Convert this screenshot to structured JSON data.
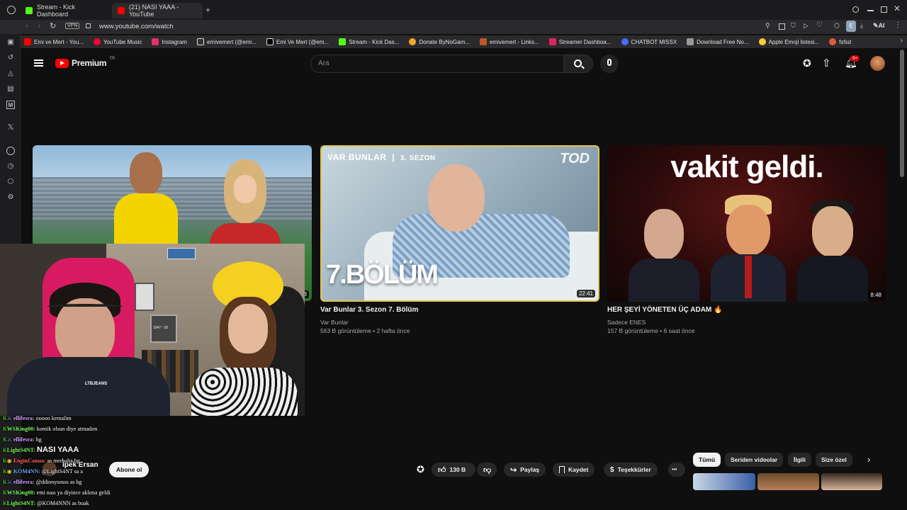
{
  "browser": {
    "tabs": [
      {
        "label": "Stream - Kick Dashboard",
        "color": "#53fc18"
      },
      {
        "label": "(21) NASI YAAA - YouTube",
        "color": "#ff0000"
      }
    ],
    "new_tab": "+",
    "url": "www.youtube.com/watch",
    "vpn_label": "VPN",
    "bookmarks": [
      {
        "label": "Emi ve Mert - You...",
        "color": "#ff0000"
      },
      {
        "label": "YouTube Music",
        "color": "#ff0033"
      },
      {
        "label": "Instagram",
        "color": "#e1306c"
      },
      {
        "label": "emivemert (@emi...",
        "color": "#eeeeee"
      },
      {
        "label": "Emi Ve Mert (@em...",
        "color": "#dddddd"
      },
      {
        "label": "Stream - Kick Das...",
        "color": "#53fc18"
      },
      {
        "label": "Donate ByNoGam...",
        "color": "#f5a623"
      },
      {
        "label": "emivemert - Links...",
        "color": "#c0552a"
      },
      {
        "label": "Streamer Dashboa...",
        "color": "#e0245e"
      },
      {
        "label": "CHATBOT MISSX",
        "color": "#4a6cff"
      },
      {
        "label": "Download Free No...",
        "color": "#999999"
      },
      {
        "label": "Apple Emoji listesi...",
        "color": "#ffcc33"
      },
      {
        "label": "fsfsd",
        "color": "#e9573f"
      }
    ],
    "ai_label": "AI"
  },
  "youtube": {
    "logo_text": "Premium",
    "region": "TR",
    "search_placeholder": "Ara",
    "notifications": "9+",
    "accent": "#ff0000"
  },
  "videos": [
    {
      "title": "",
      "channel": "",
      "meta": "",
      "duration": "3"
    },
    {
      "title": "Var Bunlar 3. Sezon 7. Bölüm",
      "channel": "Var Bunlar",
      "meta": "563 B görüntüleme • 2 hafta önce",
      "duration": "22:41",
      "thumb_top": "VAR BUNLAR",
      "thumb_season": "3. SEZON",
      "thumb_big": "7.BÖLÜM",
      "thumb_logo": "TOD"
    },
    {
      "title": "HER ŞEYİ YÖNETEN ÜÇ ADAM 🔥",
      "channel": "Sadece ENES",
      "meta": "157 B görüntüleme • 6 saat önce",
      "duration": "8:48",
      "thumb_text": "vakit geldi."
    }
  ],
  "player": {
    "video_title": "NASI YAAA",
    "channel": "İpek Ersan",
    "subscribe": "Abone ol",
    "likes": "130 B",
    "share": "Paylaş",
    "save": "Kaydet",
    "thanks": "Teşekkürler",
    "more": "•••"
  },
  "chips": [
    {
      "label": "Tümü",
      "active": true
    },
    {
      "label": "Seriden videolar",
      "active": false
    },
    {
      "label": "İlgili",
      "active": false
    },
    {
      "label": "Size özel",
      "active": false
    }
  ],
  "chat": [
    {
      "user": "ellifesra:",
      "msg": "ooooo kemalim",
      "color": "#d8a0ff"
    },
    {
      "user": "WSKing00:",
      "msg": "komik olsun diye atmadım",
      "color": "#7dfc5c"
    },
    {
      "user": "ellifesra:",
      "msg": "hg",
      "color": "#d8a0ff"
    },
    {
      "user": "LightS4NT:",
      "msg": "",
      "color": "#7dfc5c"
    },
    {
      "user": "EnginCanua:",
      "msg": "as merhaba hg",
      "color": "#ff6060"
    },
    {
      "user": "KOM4NN:",
      "msg": "@LightS4NT sa a",
      "color": "#6aa8ff"
    },
    {
      "user": "ellifesra:",
      "msg": "@ddionysosss as hg",
      "color": "#d8a0ff"
    },
    {
      "user": "WSKing00:",
      "msg": "emi nası ya diyince aklıma geldi",
      "color": "#7dfc5c"
    },
    {
      "user": "LightS4NT:",
      "msg": "@KOM4NNN as buak",
      "color": "#7dfc5c"
    }
  ],
  "webcam": {
    "shirt_text": "LTBJEANS",
    "frame_text": "1947 - 00"
  }
}
